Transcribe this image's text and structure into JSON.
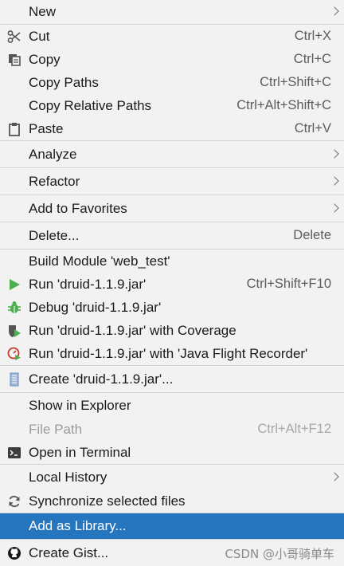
{
  "menu": {
    "new": "New",
    "cut": "Cut",
    "cut_shortcut": "Ctrl+X",
    "copy": "Copy",
    "copy_shortcut": "Ctrl+C",
    "copy_paths": "Copy Paths",
    "copy_paths_shortcut": "Ctrl+Shift+C",
    "copy_relative_paths": "Copy Relative Paths",
    "copy_relative_paths_shortcut": "Ctrl+Alt+Shift+C",
    "paste": "Paste",
    "paste_shortcut": "Ctrl+V",
    "analyze": "Analyze",
    "refactor": "Refactor",
    "add_to_favorites": "Add to Favorites",
    "delete": "Delete...",
    "delete_shortcut": "Delete",
    "build_module": "Build Module 'web_test'",
    "run": "Run 'druid-1.1.9.jar'",
    "run_shortcut": "Ctrl+Shift+F10",
    "debug": "Debug 'druid-1.1.9.jar'",
    "run_coverage": "Run 'druid-1.1.9.jar' with Coverage",
    "run_jfr": "Run 'druid-1.1.9.jar' with 'Java Flight Recorder'",
    "create": "Create 'druid-1.1.9.jar'...",
    "show_in_explorer": "Show in Explorer",
    "file_path": "File Path",
    "file_path_shortcut": "Ctrl+Alt+F12",
    "open_in_terminal": "Open in Terminal",
    "local_history": "Local History",
    "synchronize": "Synchronize selected files",
    "add_as_library": "Add as Library...",
    "create_gist": "Create Gist..."
  },
  "watermark": "CSDN @小哥骑单车",
  "icons": {
    "cut": "scissors-icon",
    "copy": "copy-icon",
    "paste": "clipboard-icon",
    "run": "run-triangle-icon",
    "debug": "bug-icon",
    "coverage": "coverage-shield-icon",
    "jfr": "flight-recorder-icon",
    "create": "run-config-icon",
    "terminal": "terminal-icon",
    "sync": "sync-icon",
    "github": "github-icon"
  },
  "colors": {
    "selection": "#2675bf",
    "run_green": "#4caf50",
    "disabled_text": "#9b9b9b"
  }
}
